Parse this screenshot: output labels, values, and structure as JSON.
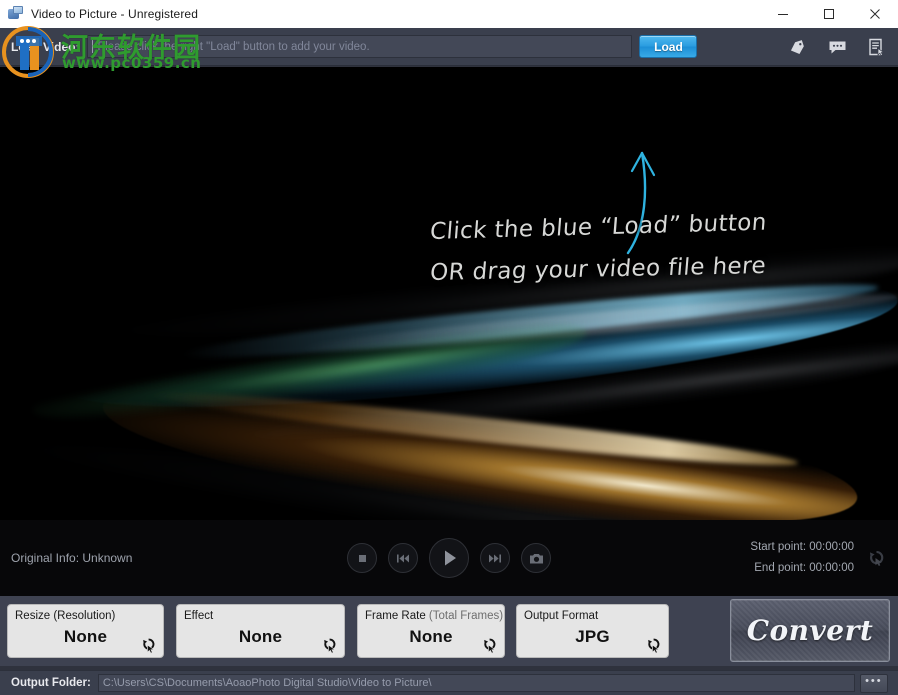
{
  "window": {
    "title": "Video to Picture - Unregistered",
    "app_icon": "video-picture-icon",
    "minimize": "minimize-icon",
    "maximize": "maximize-icon",
    "close": "close-icon"
  },
  "load_bar": {
    "label": "Load Video:",
    "input_value": "",
    "input_placeholder": "Please click the right \"Load\" button to add your video.",
    "load_button": "Load",
    "icons": [
      {
        "name": "tag-icon"
      },
      {
        "name": "feedback-icon"
      },
      {
        "name": "register-icon"
      }
    ]
  },
  "stage": {
    "hint_line1": "Click the blue “Load” button",
    "hint_line2": "OR drag your video file here",
    "arrow": "curved-up-arrow",
    "arrow_color": "#2fb3e0"
  },
  "watermark": {
    "chinese": "河东软件园",
    "url": "www.pc0359.cn",
    "color": "#2f9b2f"
  },
  "player": {
    "original_info": "Original Info: Unknown",
    "controls": [
      {
        "name": "stop-button"
      },
      {
        "name": "previous-frame-button"
      },
      {
        "name": "play-button"
      },
      {
        "name": "next-frame-button"
      },
      {
        "name": "snapshot-button"
      }
    ],
    "start_point_label": "Start point:",
    "start_point_value": "00:00:00",
    "end_point_label": "End point:",
    "end_point_value": "00:00:00",
    "reset_icon": "reset-cursor-icon"
  },
  "settings": {
    "cards": [
      {
        "label": "Resize (Resolution)",
        "label_muted": "",
        "value": "None",
        "icon": "cursor-settings-icon"
      },
      {
        "label": "Effect",
        "label_muted": "",
        "value": "None",
        "icon": "cursor-settings-icon"
      },
      {
        "label": "Frame Rate ",
        "label_muted": "(Total Frames)",
        "value": "None",
        "icon": "cursor-settings-icon"
      },
      {
        "label": "Output Format",
        "label_muted": "",
        "value": "JPG",
        "icon": "cursor-settings-icon"
      }
    ],
    "convert_button": "Convert"
  },
  "output": {
    "label": "Output Folder:",
    "path": "C:\\Users\\CS\\Documents\\AoaoPhoto Digital Studio\\Video to Picture\\",
    "browse_button": "•••"
  },
  "colors": {
    "accent_blue": "#2a9ce0",
    "chrome_dark": "#3a3f4d",
    "settings_strip": "#3e4251",
    "card_bg": "#e5e5e5",
    "stage_bg": "#000000"
  }
}
